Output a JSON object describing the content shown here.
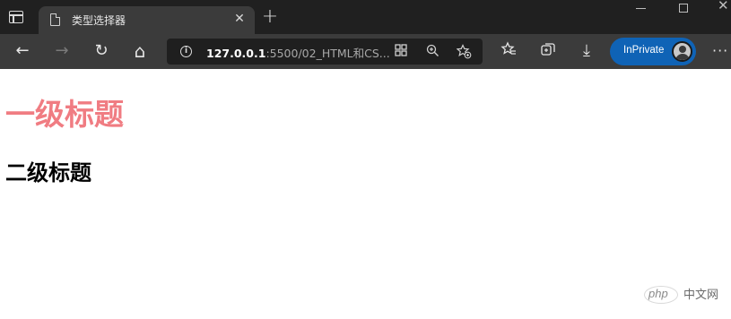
{
  "browser": {
    "tab": {
      "title": "类型选择器",
      "close_glyph": "✕"
    },
    "new_tab_glyph": "+",
    "window_controls": {
      "close_glyph": "✕"
    },
    "toolbar": {
      "back_glyph": "←",
      "forward_glyph": "→",
      "refresh_glyph": "↻",
      "home_glyph": "⌂",
      "url_host": "127.0.0.1",
      "url_rest": ":5500/02_HTML和CS...",
      "favorites_glyph": "☆",
      "downloads_glyph": "⤓",
      "more_glyph": "···",
      "inprivate_label": "InPrivate"
    },
    "icons": {
      "tab_actions": "tab-actions-icon",
      "page": "page-icon",
      "info": "info-icon",
      "app_available": "app-available-icon",
      "zoom": "zoom-icon",
      "add_favorite": "add-favorite-icon",
      "favorites": "favorites-icon",
      "collections": "collections-icon",
      "downloads": "download-icon",
      "profile": "profile-avatar"
    }
  },
  "page": {
    "heading1": "一级标题",
    "heading2": "二级标题",
    "heading1_color": "#f07c82",
    "heading2_color": "#000000"
  },
  "watermark": {
    "logo_text": "php",
    "site_text": "中文网"
  }
}
